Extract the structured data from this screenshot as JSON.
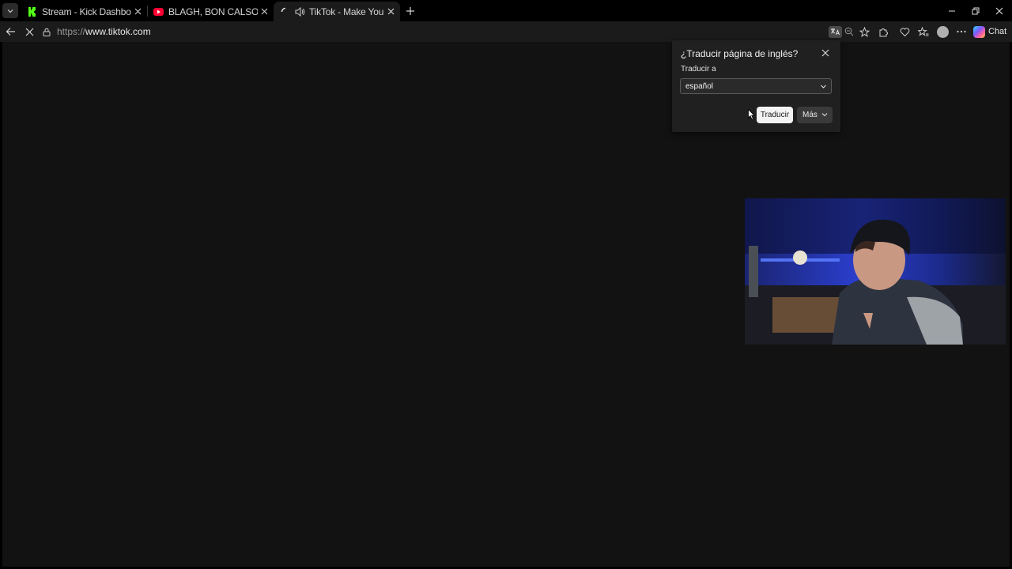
{
  "browser": {
    "tabs": [
      {
        "title": "Stream - Kick Dashboard",
        "favicon": "kick-logo-icon",
        "active": false
      },
      {
        "title": "BLAGH, BON CALSO - GANSTER -",
        "favicon": "youtube-logo-icon",
        "active": false
      },
      {
        "title": "TikTok - Make Your Day",
        "favicon": "loading-spinner-icon",
        "active": true,
        "audio": true
      }
    ],
    "address": {
      "protocol": "https://",
      "host": "www.tiktok.com"
    },
    "chat_label": "Chat"
  },
  "translate_popup": {
    "title": "¿Traducir página de inglés?",
    "target_label": "Traducir a",
    "selected_language": "español",
    "translate_button": "Traducir",
    "more_button": "Más"
  },
  "colors": {
    "page_background": "#121212",
    "toolbar": "#1b1b1b",
    "kick_green": "#53fc18",
    "youtube_red": "#ff0033"
  }
}
